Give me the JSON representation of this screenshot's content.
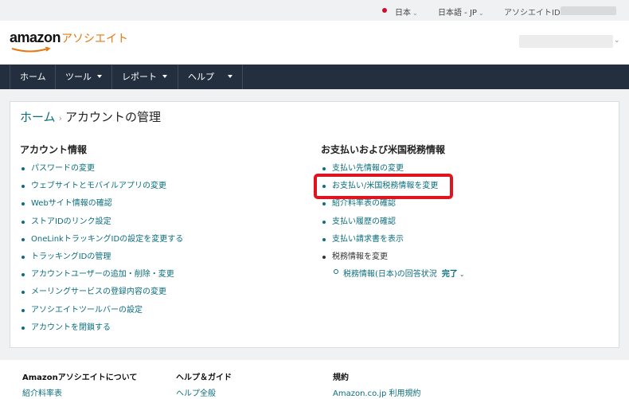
{
  "topbar": {
    "flag_color": "#c8102e",
    "country": "日本",
    "language": "日本語 - JP",
    "associate_id_label": "アソシエイトID:"
  },
  "header": {
    "logo_wordmark": "amazon",
    "logo_suffix": "アソシエイト"
  },
  "nav": {
    "items": [
      {
        "label": "ホーム"
      },
      {
        "label": "ツール"
      },
      {
        "label": "レポート"
      },
      {
        "label": "ヘルプ"
      }
    ]
  },
  "breadcrumb": {
    "home": "ホーム",
    "separator": "›",
    "current": "アカウントの管理"
  },
  "account_info": {
    "title": "アカウント情報",
    "links": [
      "パスワードの変更",
      "ウェブサイトとモバイルアプリの変更",
      "Webサイト情報の確認",
      "ストアIDのリンク設定",
      "OneLinkトラッキングIDの設定を変更する",
      "トラッキングIDの管理",
      "アカウントユーザーの追加・削除・変更",
      "メーリングサービスの登録内容の変更",
      "アソシエイトツールバーの設定",
      "アカウントを閉鎖する"
    ]
  },
  "payment_info": {
    "title": "お支払いおよび米国税務情報",
    "links": [
      "支払い先情報の変更",
      "お支払い/米国税務情報を変更",
      "紹介料率表の確認",
      "支払い履歴の確認",
      "支払い請求書を表示"
    ],
    "tax_header": "税務情報を変更",
    "tax_sub_item": "税務情報(日本)の回答状況",
    "tax_status": "完了"
  },
  "footer": {
    "columns": [
      {
        "heading": "Amazonアソシエイトについて",
        "link": "紹介料率表"
      },
      {
        "heading": "ヘルプ＆ガイド",
        "link": "ヘルプ全般"
      },
      {
        "heading": "規約",
        "link": "Amazon.co.jp 利用規約"
      }
    ]
  },
  "colors": {
    "nav_bg": "#232f3e",
    "link": "#0b6e7d",
    "accent_orange": "#e47911",
    "highlight_red": "#e0141e"
  }
}
